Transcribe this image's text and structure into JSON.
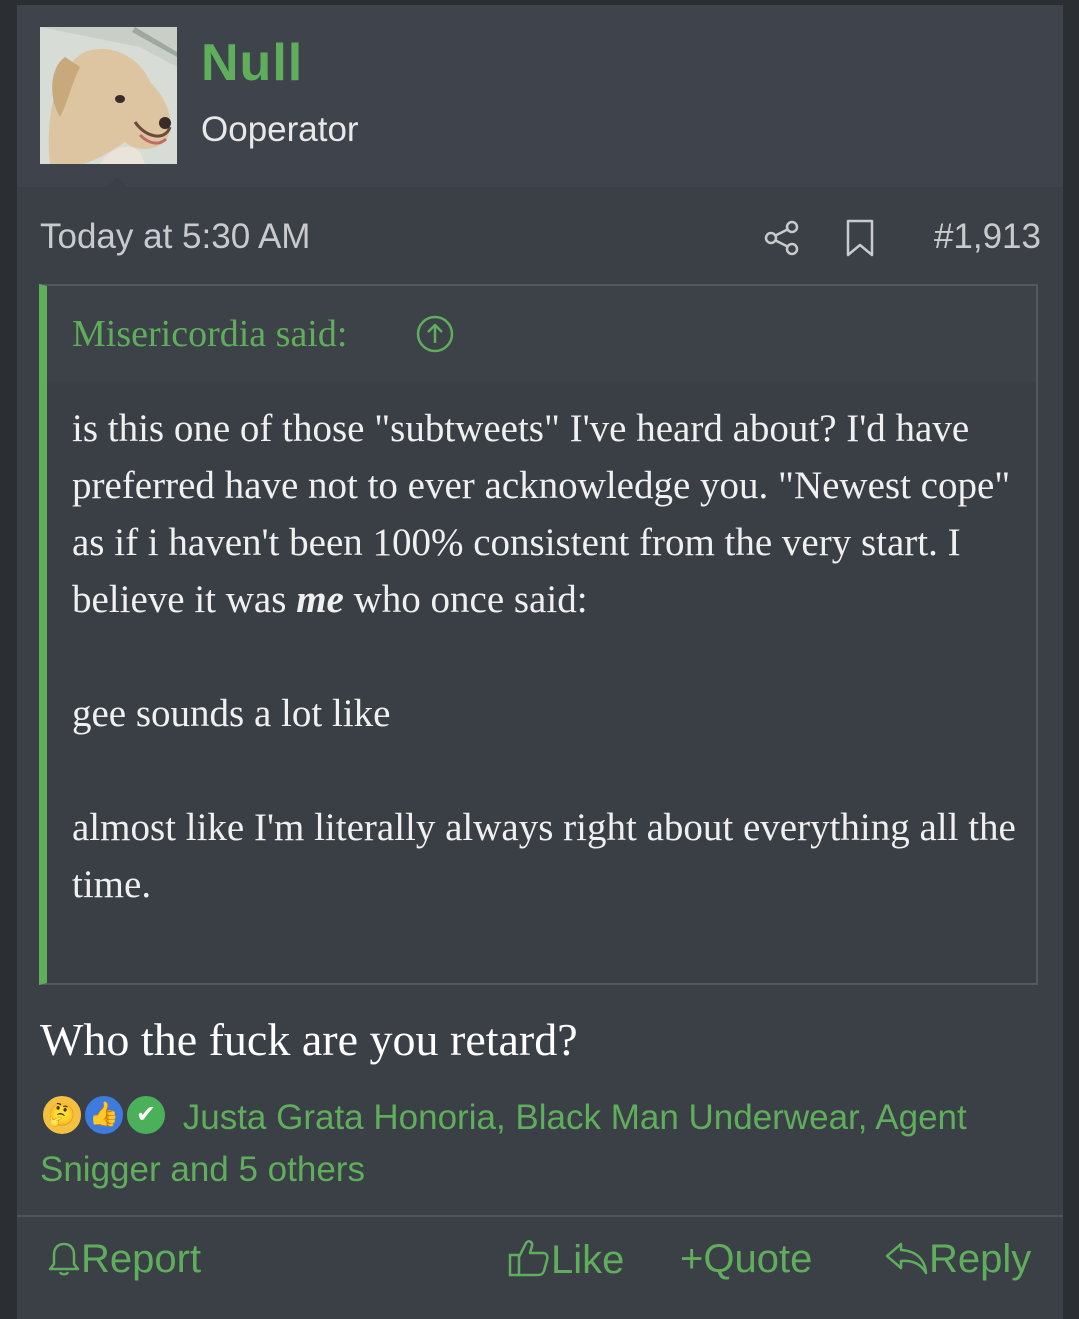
{
  "user": {
    "name": "Null",
    "title": "Ooperator"
  },
  "meta": {
    "date": "Today at 5:30 AM",
    "post_number": "#1,913"
  },
  "quote": {
    "author_label": "Misericordia said:",
    "para1_before": "is this one of those \"subtweets\" I've heard about? I'd have preferred have not to ever acknowledge you. \"Newest cope\" as if i haven't been 100% consistent from the very start. I believe it was ",
    "para1_emphasis": "me",
    "para1_after": " who once said:",
    "para2": "gee sounds a lot like",
    "para3": "almost like I'm literally always right about everything all the time."
  },
  "reply": {
    "text": "Who the fuck are you retard?"
  },
  "reactions": {
    "names": "Justa Grata Honoria, Black Man Underwear, Agent Snigger and 5 others",
    "icons": [
      "thinking-face-icon",
      "thumbs-up-icon",
      "check-icon"
    ]
  },
  "actions": {
    "report": "Report",
    "like": "Like",
    "quote": "Quote",
    "reply": "Reply"
  },
  "colors": {
    "accent": "#5fae5c",
    "background": "#3b3f46",
    "text": "#f0f0f0"
  }
}
